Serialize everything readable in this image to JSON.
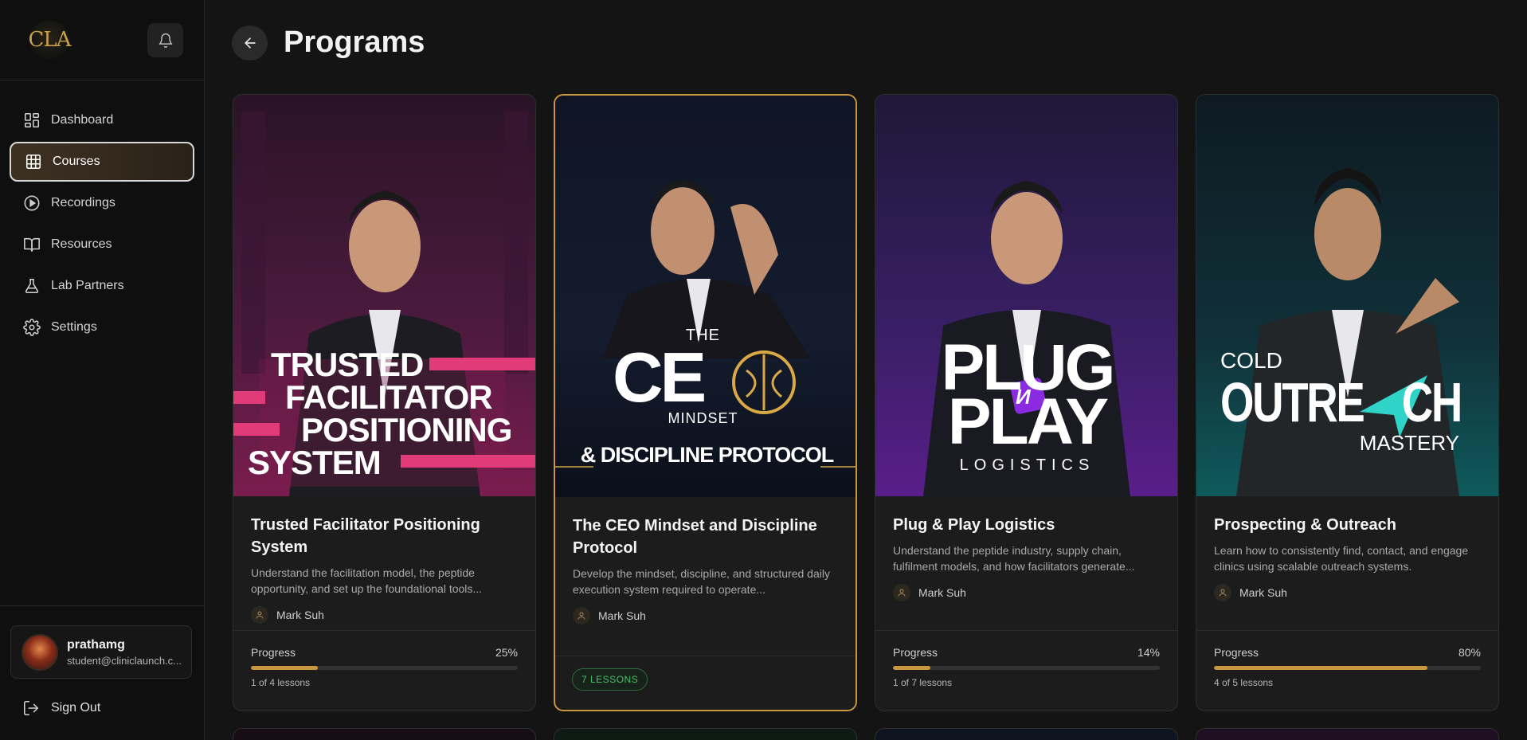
{
  "app": {
    "logo_text": "CLA"
  },
  "header": {
    "title": "Programs"
  },
  "sidebar": {
    "items": [
      {
        "label": "Dashboard",
        "icon": "dashboard-icon",
        "active": false
      },
      {
        "label": "Courses",
        "icon": "grid-icon",
        "active": true
      },
      {
        "label": "Recordings",
        "icon": "play-circle-icon",
        "active": false
      },
      {
        "label": "Resources",
        "icon": "book-icon",
        "active": false
      },
      {
        "label": "Lab Partners",
        "icon": "flask-icon",
        "active": false
      },
      {
        "label": "Settings",
        "icon": "gear-icon",
        "active": false
      }
    ],
    "user": {
      "name": "prathamg",
      "email": "student@cliniclaunch.c..."
    },
    "sign_out_label": "Sign Out"
  },
  "colors": {
    "accent": "#c9953e",
    "badge_green": "#4cbf6a",
    "background": "#141414"
  },
  "courses": [
    {
      "title": "Trusted Facilitator Positioning System",
      "description": "Understand the facilitation model, the peptide opportunity, and set up the foundational tools...",
      "author": "Mark Suh",
      "progress_label": "Progress",
      "progress_percent": "25%",
      "progress_value": 0.25,
      "lessons_text": "1 of 4 lessons",
      "cover_lines": [
        "TRUSTED",
        "FACILITATOR",
        "POSITIONING",
        "SYSTEM"
      ]
    },
    {
      "title": "The CEO Mindset and Discipline Protocol",
      "description": "Develop the mindset, discipline, and structured daily execution system required to operate...",
      "author": "Mark Suh",
      "badge": "7 LESSONS",
      "cover_lines": [
        "THE",
        "CE",
        "MINDSET",
        "& DISCIPLINE PROTOCOL"
      ]
    },
    {
      "title": "Plug & Play Logistics",
      "description": "Understand the peptide industry, supply chain, fulfilment models, and how facilitators generate...",
      "author": "Mark Suh",
      "progress_label": "Progress",
      "progress_percent": "14%",
      "progress_value": 0.14,
      "lessons_text": "1 of 7 lessons",
      "cover_lines": [
        "PLUG",
        "PLAY",
        "И",
        "LOGISTICS"
      ]
    },
    {
      "title": "Prospecting & Outreach",
      "description": "Learn how to consistently find, contact, and engage clinics using scalable outreach systems.",
      "author": "Mark Suh",
      "progress_label": "Progress",
      "progress_percent": "80%",
      "progress_value": 0.8,
      "lessons_text": "4 of 5 lessons",
      "cover_lines": [
        "COLD",
        "OUTRE",
        "CH",
        "MASTERY"
      ]
    }
  ]
}
